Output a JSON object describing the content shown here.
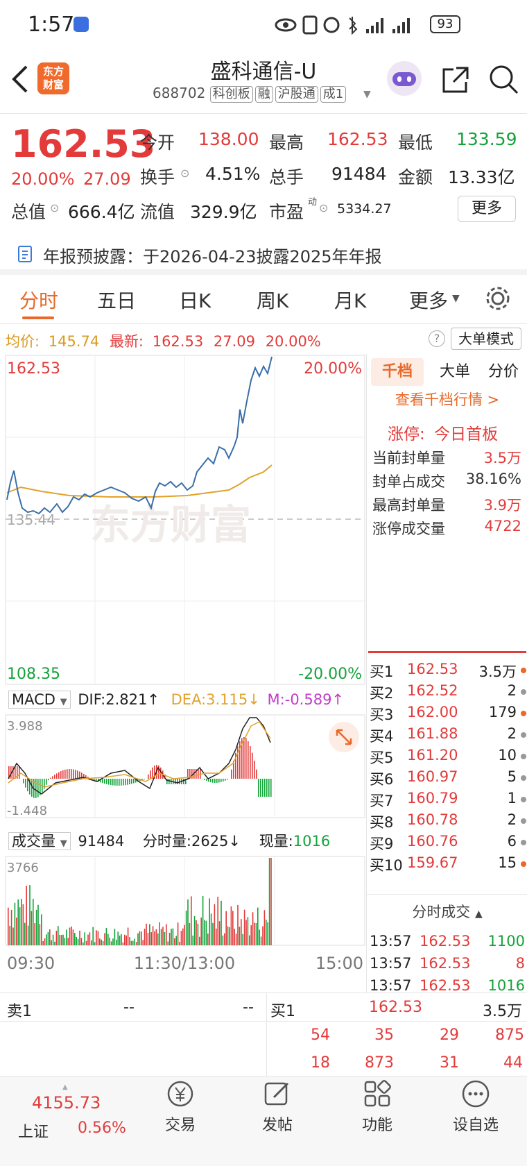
{
  "status_bar": {
    "time": "1:57",
    "battery": "93"
  },
  "header": {
    "logo_text_1": "东方",
    "logo_text_2": "财富",
    "title": "盛科通信-U",
    "code": "688702",
    "tags": [
      "科创板",
      "融",
      "沪股通",
      "成1"
    ]
  },
  "quote": {
    "price": "162.53",
    "change_pct": "20.00%",
    "change": "27.09",
    "open_label": "今开",
    "open": "138.00",
    "high_label": "最高",
    "high": "162.53",
    "low_label": "最低",
    "low": "133.59",
    "turnover_label": "换手",
    "turnover": "4.51%",
    "volume_label": "总手",
    "volume": "91484",
    "amount_label": "金额",
    "amount": "13.33亿",
    "mktcap_label": "总值",
    "mktcap": "666.4亿",
    "float_label": "流值",
    "float": "329.9亿",
    "pe_label": "市盈",
    "pe_sup": "动",
    "pe": "5334.27",
    "more_button": "更多"
  },
  "notice": {
    "text": "年报预披露：于2026-04-23披露2025年年报"
  },
  "tabs": [
    "分时",
    "五日",
    "日K",
    "周K",
    "月K",
    "更多"
  ],
  "info_row": {
    "avg_label": "均价:",
    "avg": "145.74",
    "latest_label": "最新:",
    "latest": "162.53",
    "change": "27.09",
    "pct": "20.00%",
    "bigorder_button": "大单模式"
  },
  "chart": {
    "top_price": "162.53",
    "top_pct": "20.00%",
    "ref_price": "135.44",
    "bottom_price": "108.35",
    "bottom_pct": "-20.00%",
    "watermark": "东方财富",
    "time_start": "09:30",
    "time_mid": "11:30/13:00",
    "time_end": "15:00"
  },
  "macd": {
    "label": "MACD",
    "dif": "DIF:2.821↑",
    "dea": "DEA:3.115↓",
    "m": "M:-0.589↑",
    "top": "3.988",
    "bottom": "-1.448"
  },
  "volume": {
    "label": "成交量",
    "total": "91484",
    "min_label": "分时量:",
    "min_val": "2625↓",
    "now_label": "现量:",
    "now_val": "1016",
    "top": "3766"
  },
  "side_tabs": [
    "千档",
    "大单",
    "分价"
  ],
  "side": {
    "link": "查看千档行情 >",
    "limit_label": "涨停:",
    "limit_text": "今日首板",
    "rows": [
      {
        "label": "当前封单量",
        "value": "3.5万"
      },
      {
        "label": "封单占成交",
        "value": "38.16%"
      },
      {
        "label": "最高封单量",
        "value": "3.9万"
      },
      {
        "label": "涨停成交量",
        "value": "4722"
      }
    ]
  },
  "bids": [
    {
      "label": "买1",
      "price": "162.53",
      "vol": "3.5万",
      "dot": "#e8692a"
    },
    {
      "label": "买2",
      "price": "162.52",
      "vol": "2",
      "dot": "#999999"
    },
    {
      "label": "买3",
      "price": "162.00",
      "vol": "179",
      "dot": "#e8692a"
    },
    {
      "label": "买4",
      "price": "161.88",
      "vol": "2",
      "dot": "#999999"
    },
    {
      "label": "买5",
      "price": "161.20",
      "vol": "10",
      "dot": "#999999"
    },
    {
      "label": "买6",
      "price": "160.97",
      "vol": "5",
      "dot": "#999999"
    },
    {
      "label": "买7",
      "price": "160.79",
      "vol": "1",
      "dot": "#999999"
    },
    {
      "label": "买8",
      "price": "160.78",
      "vol": "2",
      "dot": "#999999"
    },
    {
      "label": "买9",
      "price": "160.76",
      "vol": "6",
      "dot": "#999999"
    },
    {
      "label": "买10",
      "price": "159.67",
      "vol": "15",
      "dot": "#e8692a"
    }
  ],
  "trades_title": "分时成交",
  "trades": [
    {
      "time": "13:57",
      "price": "162.53",
      "vol": "1100",
      "color": "#14a33a"
    },
    {
      "time": "13:57",
      "price": "162.53",
      "vol": "8",
      "color": "#e33a3a"
    },
    {
      "time": "13:57",
      "price": "162.53",
      "vol": "1016",
      "color": "#14a33a"
    }
  ],
  "bottom_book": {
    "sell_label": "卖1",
    "sell_price": "--",
    "sell_vol": "--",
    "buy_label": "买1",
    "buy_price": "162.53",
    "buy_vol": "3.5万",
    "row1": [
      "54",
      "35",
      "29",
      "875"
    ],
    "row2": [
      "18",
      "873",
      "31",
      "44"
    ]
  },
  "bottom_nav": {
    "index_value": "4155.73",
    "index_name": "上证",
    "index_pct": "0.56%",
    "items": [
      "交易",
      "发帖",
      "功能",
      "设自选"
    ]
  }
}
